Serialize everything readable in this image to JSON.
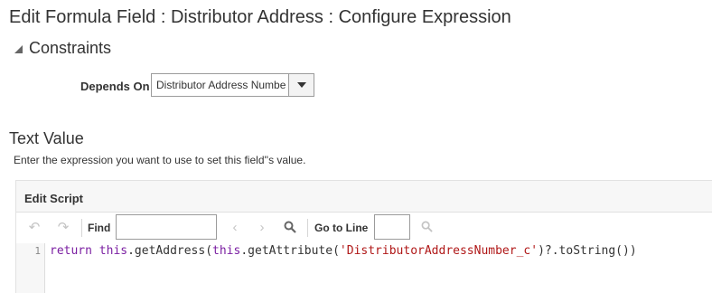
{
  "page": {
    "title": "Edit Formula Field : Distributor Address : Configure Expression"
  },
  "constraints": {
    "header": "Constraints",
    "depends_on_label": "Depends On",
    "depends_on_value": "Distributor Address Numbe"
  },
  "text_value": {
    "heading": "Text Value",
    "hint": "Enter the expression you want to use to set this field''s value."
  },
  "editor": {
    "title": "Edit Script",
    "find_label": "Find",
    "find_value": "",
    "goto_label": "Go to Line",
    "goto_value": "",
    "icons": [
      "undo-icon",
      "redo-icon",
      "chevron-left-icon",
      "chevron-right-icon",
      "search-icon",
      "search-icon"
    ],
    "line_number": "1",
    "code": {
      "t1": "return",
      "t2": " ",
      "t3": "this",
      "t4": ".getAddress(",
      "t5": "this",
      "t6": ".getAttribute(",
      "t7": "'DistributorAddressNumber_c'",
      "t8": ")?.toString())"
    }
  },
  "colors": {
    "keyword": "#7b1fa2",
    "string": "#b01818",
    "panel_bg": "#f7f7f7"
  }
}
